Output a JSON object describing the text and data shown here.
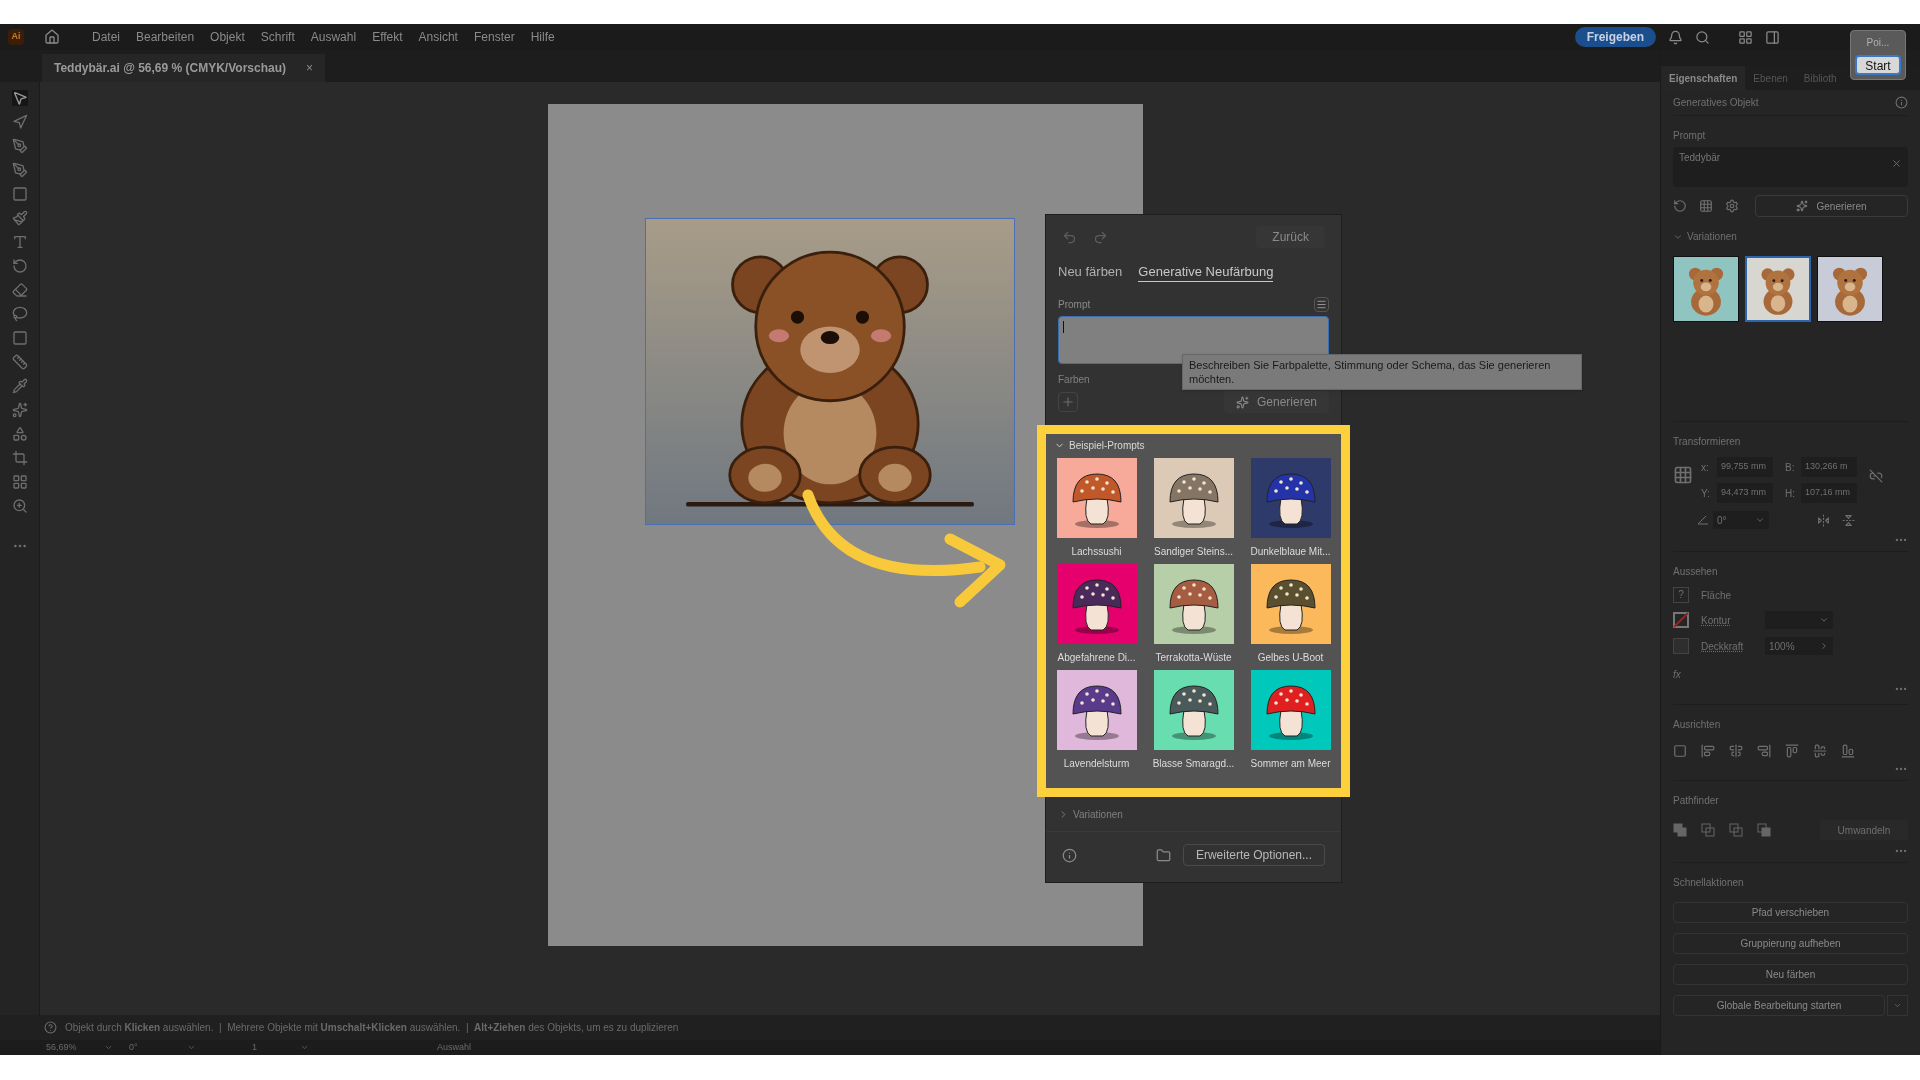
{
  "menubar": {
    "app_logo": "Ai",
    "items": [
      "Datei",
      "Bearbeiten",
      "Objekt",
      "Schrift",
      "Auswahl",
      "Effekt",
      "Ansicht",
      "Fenster",
      "Hilfe"
    ],
    "share_button": "Freigeben"
  },
  "popover": {
    "title": "Poi...",
    "button": "Start"
  },
  "document_tab": {
    "title": "Teddybär.ai @ 56,69 % (CMYK/Vorschau)",
    "close": "×"
  },
  "recolor_panel": {
    "back_button": {
      "label": "Zurück",
      "disabled": true
    },
    "tabs": [
      {
        "label": "Neu färben",
        "selected": false
      },
      {
        "label": "Generative Neufärbung",
        "selected": true
      }
    ],
    "prompt_label": "Prompt",
    "tooltip": "Beschreiben Sie Farbpalette, Stimmung oder Schema, das Sie generieren möchten.",
    "colors_label": "Farben",
    "generate_button": {
      "label": "Generieren",
      "disabled": true
    },
    "sample_prompts": {
      "title": "Beispiel-Prompts",
      "expanded": true,
      "items": [
        {
          "label": "Lachssushi",
          "color": "#f7a99a"
        },
        {
          "label": "Sandiger Steins...",
          "color": "#dcc9b6"
        },
        {
          "label": "Dunkelblaue Mit...",
          "color": "#2d3a6a"
        },
        {
          "label": "Abgefahrene Di...",
          "color": "#e6006e"
        },
        {
          "label": "Terrakotta-Wüste",
          "color": "#b7cfa9"
        },
        {
          "label": "Gelbes U-Boot",
          "color": "#fcb95b"
        },
        {
          "label": "Lavendelsturm",
          "color": "#e0b8dc"
        },
        {
          "label": "Blasse Smaragd...",
          "color": "#67ddb0"
        },
        {
          "label": "Sommer am Meer",
          "color": "#00c9bb"
        }
      ]
    },
    "variations": {
      "title": "Variationen",
      "expanded": false
    },
    "advanced_button": "Erweiterte Optionen..."
  },
  "properties_panel": {
    "tabs": [
      {
        "label": "Eigenschaften",
        "selected": true
      },
      {
        "label": "Ebenen",
        "selected": false
      },
      {
        "label": "Biblioth",
        "selected": false
      }
    ],
    "section_title": "Generatives Objekt",
    "prompt_label": "Prompt",
    "prompt_value": "Teddybär",
    "generate_button": "Generieren",
    "variations": {
      "title": "Variationen",
      "expanded": true,
      "items": [
        {
          "selected": false,
          "color": "#8fc4c0"
        },
        {
          "selected": true,
          "color": "#d8d6d0"
        },
        {
          "selected": false,
          "color": "#c8ccd8"
        }
      ]
    },
    "transform": {
      "title": "Transformieren",
      "fields": [
        {
          "label": "x:",
          "value": "99,755 mm"
        },
        {
          "label": "B:",
          "value": "130,266 m"
        },
        {
          "label": "Y:",
          "value": "94,473 mm"
        },
        {
          "label": "H:",
          "value": "107,16 mm"
        }
      ],
      "angle": "0°"
    },
    "appearance": {
      "title": "Aussehen",
      "fill_value": "?",
      "fill_label": "Fläche",
      "stroke_label": "Kontur",
      "opacity_label": "Deckkraft",
      "opacity_value": "100%",
      "fx": "fx"
    },
    "align": {
      "title": "Ausrichten"
    },
    "pathfinder": {
      "title": "Pathfinder",
      "convert_button": {
        "label": "Umwandeln",
        "disabled": true
      }
    },
    "quick_actions": {
      "title": "Schnellaktionen",
      "buttons": [
        "Pfad verschieben",
        "Gruppierung aufheben",
        "Neu färben",
        "Globale Bearbeitung starten"
      ]
    }
  },
  "status": {
    "hint": "Objekt durch **Klicken** auswählen.  |  Mehrere Objekte mit **Umschalt+Klicken** auswählen.  |  **Alt+Ziehen** des Objekts, um es zu duplizieren",
    "zoom": "56,69%",
    "rotation": "0°",
    "artboard": "1",
    "tool": "Auswahl"
  }
}
